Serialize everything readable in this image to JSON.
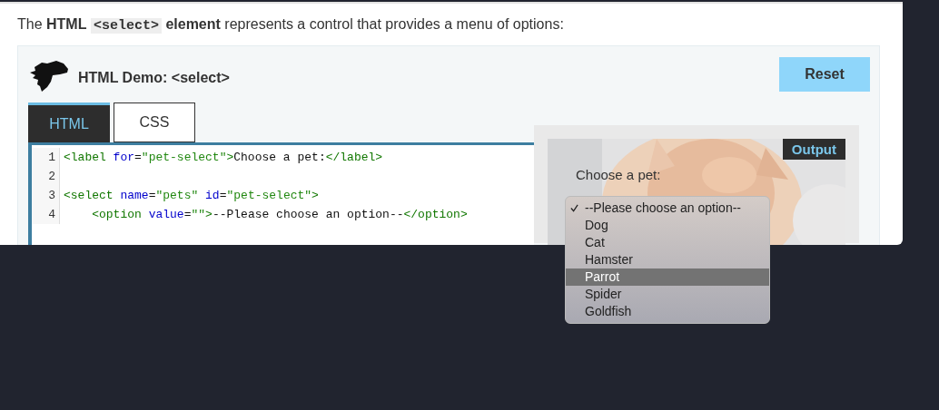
{
  "intro_parts": [
    {
      "kind": "text",
      "text": "The"
    },
    {
      "kind": "bold",
      "text": "HTML"
    },
    {
      "kind": "code",
      "text": "<select>"
    },
    {
      "kind": "bold",
      "text": "element"
    },
    {
      "kind": "text",
      "text": "represents a control that provides a menu of options:"
    }
  ],
  "demo": {
    "title": "HTML Demo: <select>",
    "reset_button": "Reset"
  },
  "tabs": [
    {
      "label": "HTML",
      "selected": true
    },
    {
      "label": "CSS",
      "selected": false
    }
  ],
  "code_lines": [
    {
      "number": "1",
      "tokens": [
        {
          "kind": "tag",
          "text": "<label "
        },
        {
          "kind": "attr",
          "text": "for"
        },
        {
          "kind": "plain",
          "text": "="
        },
        {
          "kind": "string",
          "text": "\"pet-select\""
        },
        {
          "kind": "tag",
          "text": ">"
        },
        {
          "kind": "plain",
          "text": "Choose a pet:"
        },
        {
          "kind": "tag",
          "text": "</label>"
        }
      ]
    },
    {
      "number": "2"
    },
    {
      "number": "3",
      "tokens": [
        {
          "kind": "tag",
          "text": "<select "
        },
        {
          "kind": "attr",
          "text": "name"
        },
        {
          "kind": "plain",
          "text": "="
        },
        {
          "kind": "string",
          "text": "\"pets\" "
        },
        {
          "kind": "attr",
          "text": "id"
        },
        {
          "kind": "plain",
          "text": "="
        },
        {
          "kind": "string",
          "text": "\"pet-select\""
        },
        {
          "kind": "tag",
          "text": ">"
        }
      ]
    },
    {
      "number": "4",
      "tokens": [
        {
          "kind": "tag",
          "text": "    <option "
        },
        {
          "kind": "attr",
          "text": "value"
        },
        {
          "kind": "plain",
          "text": "="
        },
        {
          "kind": "string",
          "text": "\"\""
        },
        {
          "kind": "tag",
          "text": ">"
        },
        {
          "kind": "plain",
          "text": "--Please choose an option--"
        },
        {
          "kind": "tag",
          "text": "</option>"
        }
      ]
    }
  ],
  "output": {
    "label": "Output",
    "field_label": "Choose a pet:"
  },
  "dropdown": [
    {
      "text": "--Please choose an option--",
      "selected": true,
      "highlighted": false
    },
    {
      "text": "Dog",
      "selected": false,
      "highlighted": false
    },
    {
      "text": "Cat",
      "selected": false,
      "highlighted": false
    },
    {
      "text": "Hamster",
      "selected": false,
      "highlighted": false
    },
    {
      "text": "Parrot",
      "selected": false,
      "highlighted": true
    },
    {
      "text": "Spider",
      "selected": false,
      "highlighted": false
    },
    {
      "text": "Goldfish",
      "selected": false,
      "highlighted": false
    }
  ]
}
